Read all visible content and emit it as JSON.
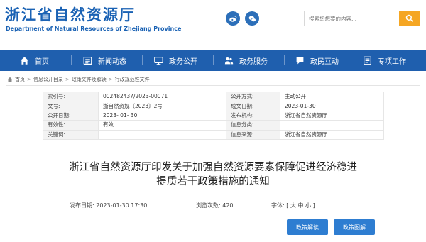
{
  "header": {
    "logo_cn": "浙江省自然资源厅",
    "logo_en": "Department of Natural Resources of Zhejiang Province",
    "search_placeholder": "搜索您想要的内容...",
    "social_icons": [
      "weibo-icon",
      "wechat-icon"
    ],
    "brand_color": "#1a62b4",
    "search_button_color": "#f5a623"
  },
  "nav": {
    "bg_color": "#1f5fae",
    "items": [
      {
        "label": "首页",
        "icon": "home-icon"
      },
      {
        "label": "新闻动态",
        "icon": "news-icon"
      },
      {
        "label": "政务公开",
        "icon": "monitor-icon"
      },
      {
        "label": "政务服务",
        "icon": "people-icon"
      },
      {
        "label": "政民互动",
        "icon": "chat-icon"
      },
      {
        "label": "专项工作",
        "icon": "list-icon"
      }
    ]
  },
  "breadcrumb": [
    "首页",
    "信息公开目录",
    "政策文件及解读",
    "行政规范性文件"
  ],
  "meta": {
    "rows": [
      {
        "k1": "索引号:",
        "v1": "002482437/2023-00071",
        "k2": "公开方式:",
        "v2": "主动公开"
      },
      {
        "k1": "文号:",
        "v1": "浙自然资规〔2023〕2号",
        "k2": "成文日期:",
        "v2": "2023-01-30"
      },
      {
        "k1": "公开日期:",
        "v1": "2023- 01- 30",
        "k2": "发布机构:",
        "v2": "浙江省自然资源厅"
      },
      {
        "k1": "有效性:",
        "v1": "有效",
        "k2": "信息分类:",
        "v2": ""
      },
      {
        "k1": "关键词:",
        "v1": "",
        "k2": "信息来源:",
        "v2": "浙江省自然资源厅"
      }
    ]
  },
  "article": {
    "title_line1": "浙江省自然资源厅印发关于加强自然资源要素保障促进经济稳进",
    "title_line2": "提质若干政策措施的通知",
    "publish_date": "发布日期: 2023-01-30 17:30",
    "views": "浏览次数: 420",
    "font_label": "字体: [ 大 中 小 ]"
  },
  "buttons": {
    "policy_interpretation": "政策解读",
    "policy_illustration": "政策图解",
    "color": "#2e7dd1"
  }
}
